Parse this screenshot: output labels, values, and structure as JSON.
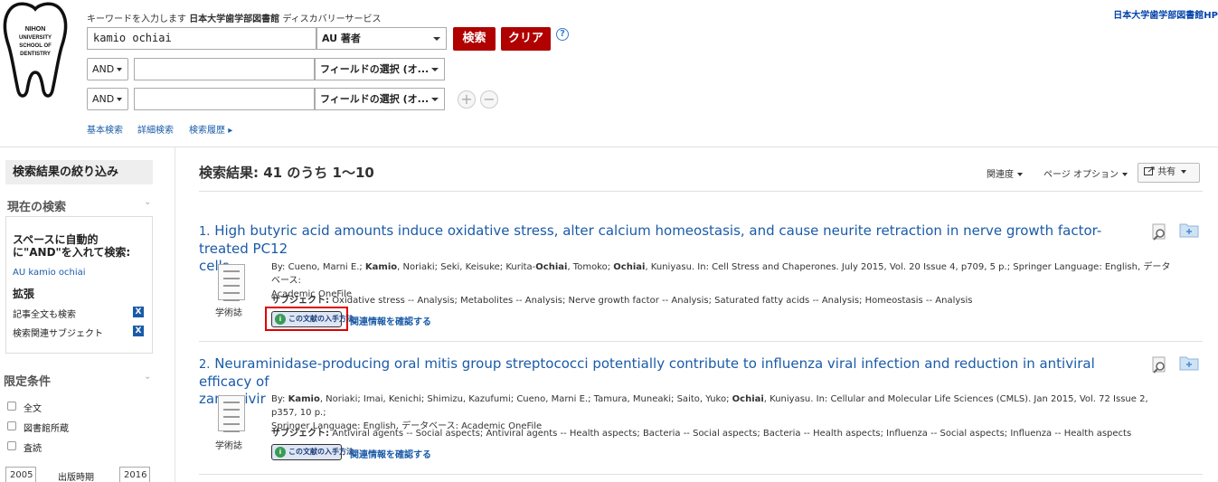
{
  "logo": {
    "lines": [
      "NIHON",
      "UNIVERSITY",
      "SCHOOL OF",
      "DENTISTRY"
    ]
  },
  "header": {
    "hint_prefix": "キーワードを入力します",
    "hint_library": "日本大学歯学部図書館",
    "hint_suffix": "ディスカバリーサービス",
    "top_right_link": "日本大学歯学部図書館HP"
  },
  "search": {
    "row1": {
      "keyword": "kamio ochiai",
      "field": "AU 著者"
    },
    "row2": {
      "operator": "AND",
      "keyword": "",
      "field": "フィールドの選択 (オ..."
    },
    "row3": {
      "operator": "AND",
      "keyword": "",
      "field": "フィールドの選択 (オ..."
    },
    "search_button": "検索",
    "clear_button": "クリア",
    "help": "?",
    "add": "+",
    "remove": "−",
    "links": [
      "基本検索",
      "詳細検索",
      "検索履歴"
    ],
    "history_arrow": "▸"
  },
  "sidebar": {
    "refine_title": "検索結果の絞り込み",
    "current_search_title": "現在の検索",
    "current_search_heading": "スペースに自動的に\"AND\"を入れて検索:",
    "current_search_term": "AU kamio ochiai",
    "expand_title": "拡張",
    "expanders": [
      {
        "label": "記事全文も検索",
        "remove": "X"
      },
      {
        "label": "検索関連サブジェクト",
        "remove": "X"
      }
    ],
    "limit_title": "限定条件",
    "limits": [
      "全文",
      "図書館所蔵",
      "査読"
    ],
    "date_from": "2005",
    "date_label": "出版時期",
    "date_to": "2016",
    "chevron": "⌄"
  },
  "results": {
    "title": "検索結果: 41 のうち 1～10",
    "sort": "関連度",
    "page_options": "ページ オプション",
    "share": "共有",
    "items": [
      {
        "number": "1.",
        "title_line1": "High butyric acid amounts induce oxidative stress, alter calcium homeostasis, and cause neurite retraction in nerve growth factor-treated PC12",
        "title_line2": "cells",
        "by_label": "By:",
        "authors_pre1": " Cueno, Marni E.; ",
        "author_bold1": "Kamio",
        "authors_mid1": ", Noriaki; Seki, Keisuke; Kurita-",
        "author_bold2": "Ochiai",
        "authors_mid2": ", Tomoko; ",
        "author_bold3": "Ochiai",
        "source": ", Kuniyasu. In: Cell Stress and Chaperones. July 2015, Vol. 20 Issue 4, p709, 5 p.; Springer Language: English, データベース:",
        "database": "Academic OneFile",
        "subject_label": "サブジェクト:",
        "subjects": "Oxidative stress -- Analysis; Metabolites -- Analysis; Nerve growth factor -- Analysis; Saturated fatty acids -- Analysis; Homeostasis -- Analysis",
        "type": "学術誌",
        "fulltext": "この文献の入手方法",
        "related": "関連情報を確認する"
      },
      {
        "number": "2.",
        "title_line1": "Neuraminidase-producing oral mitis group streptococci potentially contribute to influenza viral infection and reduction in antiviral efficacy of",
        "title_line2": "zanamivir",
        "by_label": "By:",
        "author_bold1": "Kamio",
        "authors_mid1": ", Noriaki; Imai, Kenichi; Shimizu, Kazufumi; Cueno, Marni E.; Tamura, Muneaki; Saito, Yuko; ",
        "author_bold2": "Ochiai",
        "source": ", Kuniyasu. In: Cellular and Molecular Life Sciences (CMLS). Jan 2015, Vol. 72 Issue 2, p357, 10 p.;",
        "database": "Springer Language: English, データベース: Academic OneFile",
        "subject_label": "サブジェクト:",
        "subjects": "Antiviral agents -- Social aspects; Antiviral agents -- Health aspects; Bacteria -- Social aspects; Bacteria -- Health aspects; Influenza -- Social aspects; Influenza -- Health aspects",
        "type": "学術誌",
        "fulltext": "この文献の入手方法",
        "related": "関連情報を確認する"
      }
    ]
  },
  "colors": {
    "accent_red": "#b00000",
    "link_blue": "#1a5ba8",
    "highlight_frame": "#e00000"
  },
  "icons": [
    "tooth-logo",
    "help-icon",
    "plus-icon",
    "minus-icon",
    "close-x-icon",
    "checkbox-icon",
    "document-icon",
    "magnifier-icon",
    "folder-add-icon",
    "share-icon",
    "caret-down-icon",
    "chevron-down-icon"
  ]
}
